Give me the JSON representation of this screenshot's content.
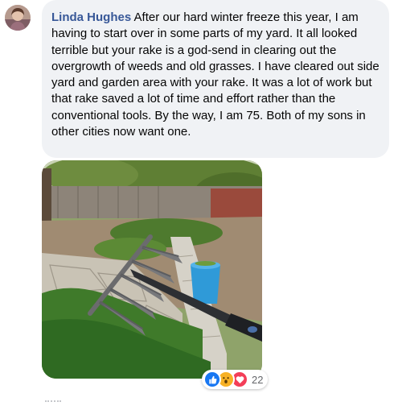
{
  "comment": {
    "author": "Linda Hughes",
    "text": "After our hard winter freeze this year, I am having to start over in some parts of my yard. It all looked terrible but your rake is a god-send in clearing out the overgrowth of weeds and old grasses. I have cleared out side yard and garden area with your rake. It was a lot of work but that rake saved a lot of time and effort rather than the conventional tools. By the way, I am 75. Both of my sons in other cities now want one."
  },
  "reactions": {
    "icons": [
      "like-icon",
      "wow-icon",
      "love-icon"
    ],
    "count": "22",
    "colors": {
      "like": "#1877f2",
      "wow": "#f7b125",
      "love": "#f33e58"
    }
  },
  "colors": {
    "author": "#385898",
    "bubble": "#f0f2f5",
    "text": "#050505"
  }
}
